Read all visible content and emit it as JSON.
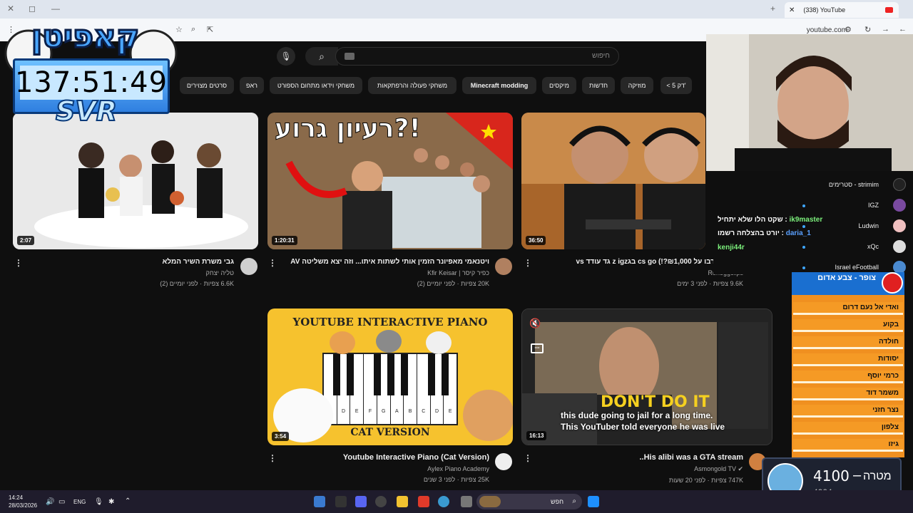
{
  "browser": {
    "tab_title": "(338) YouTube",
    "url": "youtube.com"
  },
  "search": {
    "placeholder": "חיפוש"
  },
  "chips": [
    "< 5 דק'",
    "מוזיקה",
    "חדשות",
    "מיקסים",
    "Minecraft modding",
    "משחקי פעולה והרפתקאות",
    "משחקי וידאו מתחום הספורט",
    "ראפ",
    "סרטים מצוירים"
  ],
  "videos": [
    {
      "title": "(הם התערבו על ₪1,000?!) cs go בגz igz גד עודד vs",
      "channel": "Roneggclips",
      "stats": "9.6K צפיות · לפני 3 ימים",
      "duration": "36:50"
    },
    {
      "title": "ויטנאמי מאפיונר הזמין אותי לשתות איתו... וזה יצא משליטה AV",
      "channel": "כפיר קיסר | Kfir Keisar",
      "stats": "20K צפיות · לפני יומיים (2)",
      "duration": "1:20:31",
      "thumb_text": "רעיון גרוע?!"
    },
    {
      "title": "גבי משרת השיר המלא",
      "channel": "טליה יצחק",
      "stats": "6.6K צפיות · לפני יומיים (2)",
      "duration": "2:07"
    },
    {
      "title": "His alibi was a GTA stream..",
      "channel": "Asmongold TV",
      "stats": "747K צפיות · לפני 20 שעות",
      "duration": "16:13",
      "thumb_text": "DON'T DO IT",
      "caption_1": "this dude going to jail for a long time.",
      "caption_2": "This YouTuber told everyone he was live"
    },
    {
      "title": "Youtube Interactive Piano (Cat Version)",
      "channel": "Aylex Piano Academy",
      "stats": "25K צפיות · לפני 3 שנים",
      "duration": "3:54",
      "thumb_title": "YOUTUBE INTERACTIVE PIANO",
      "thumb_sub": "CAT VERSION",
      "keys": [
        "C",
        "D",
        "E",
        "F",
        "G",
        "A",
        "B",
        "C",
        "D",
        "E"
      ]
    }
  ],
  "overlay": {
    "logo_text": "קאפיטן",
    "timer": "137:51:49",
    "tag": "SVR"
  },
  "subscriptions": [
    {
      "name": "סטרימים - strimim"
    },
    {
      "name": "IGZ"
    },
    {
      "name": "Ludwin"
    },
    {
      "name": "xQc"
    },
    {
      "name": "Israel eFootball"
    }
  ],
  "chat": [
    {
      "user": "ik9master",
      "text": "שקט הלו שלא יתחיל :"
    },
    {
      "user": "daria_1",
      "text": "יורט בהצלחה רשמו :"
    },
    {
      "user": "kenji44r",
      "text": ""
    }
  ],
  "alert_panel": {
    "header": "צופר - צבע אדום",
    "rows": [
      "ואדי אל נעם דרום",
      "בקוע",
      "חולדה",
      "יסודות",
      "כרמי יוסף",
      "משמר דוד",
      "נצר חזני",
      "צלפון",
      "גיזו"
    ]
  },
  "goal": {
    "label": "מטרה",
    "target": "4100",
    "current": "4004"
  },
  "taskbar": {
    "time": "14:24",
    "date": "28/03/2026",
    "lang": "ENG",
    "search": "חפש"
  },
  "colors": {
    "bg": "#0f0f0f",
    "accent_red": "#ff0033",
    "panel_orange": "#f09020",
    "panel_blue": "#1a6fd0"
  }
}
